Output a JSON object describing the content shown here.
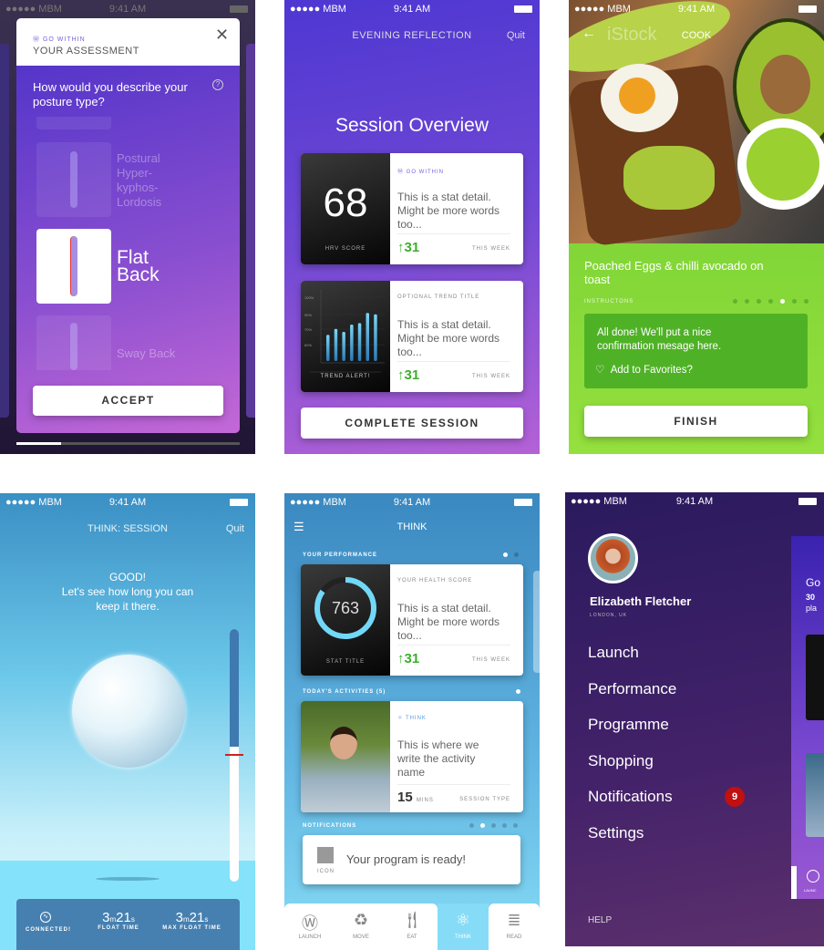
{
  "status_bar": {
    "carrier": "●●●●● MBM",
    "time": "9:41 AM"
  },
  "assessment": {
    "brand": "GO WITHIN",
    "title": "YOUR ASSESSMENT",
    "question": "How would you describe your posture type?",
    "options": [
      {
        "label": "Postural Hyper-kyphos-Lordosis"
      },
      {
        "label": "Flat Back",
        "selected": true
      },
      {
        "label": "Sway Back"
      }
    ],
    "accept": "ACCEPT",
    "progress_percent": 20
  },
  "reflection": {
    "header": "EVENING REFLECTION",
    "quit": "Quit",
    "title": "Session Overview",
    "card1": {
      "score": "68",
      "score_label": "HRV SCORE",
      "brand": "GO WITHIN",
      "detail": "This is a stat detail. Might be more words too...",
      "delta": "31",
      "period": "THIS WEEK"
    },
    "card2": {
      "trend_title": "OPTIONAL TREND TITLE",
      "alert": "TREND ALERT!",
      "ticks": [
        "100%",
        "90%",
        "70%",
        "60%"
      ],
      "bars": [
        73,
        77,
        75,
        80,
        81,
        88,
        87
      ],
      "detail": "This is a stat detail. Might be more words too...",
      "delta": "31",
      "period": "THIS WEEK"
    },
    "complete": "COMPLETE SESSION"
  },
  "cook": {
    "header": "COOK",
    "watermark": "iStock",
    "title": "Poached Eggs & chilli avocado on toast",
    "instructions": "INSTRUCTONS",
    "step_total": 7,
    "step_current": 5,
    "message": "All done! We'll put a nice confirmation mesage here.",
    "favorite": "Add to Favorites?",
    "finish": "FINISH",
    "colors": {
      "green": "#74d031",
      "box": "#4fb226"
    }
  },
  "think_session": {
    "header": "THINK: SESSION",
    "quit": "Quit",
    "message_title": "GOOD!",
    "message": "Let's see how long you can keep it there.",
    "level_percent": 57,
    "stats": [
      {
        "label": "CONNECTED!"
      },
      {
        "m": "3",
        "s": "21",
        "label": "FLOAT TIME"
      },
      {
        "m": "3",
        "s": "21",
        "label": "MAX FLOAT TIME"
      }
    ],
    "unit_m": "m",
    "unit_s": "s"
  },
  "think": {
    "header": "THINK",
    "perf_label": "YOUR PERFORMANCE",
    "card1": {
      "score": "763",
      "score_label": "STAT TITLE",
      "subtitle": "YOUR HEALTH SCORE",
      "detail": "This is a stat detail. Might be more words too...",
      "delta": "31",
      "period": "THIS WEEK",
      "ring_percent": 85
    },
    "activities_label": "TODAY'S ACTIVITIES (5)",
    "card2": {
      "tag": "THINK",
      "name": "This is where we write the activity name",
      "mins": "15",
      "mins_label": "MINS",
      "type": "SESSION TYPE"
    },
    "notifications_label": "NOTIFICATIONS",
    "notification": {
      "icon_label": "ICON",
      "text": "Your program is ready!"
    },
    "tabs": [
      {
        "label": "LAUNCH",
        "icon": "launch-icon"
      },
      {
        "label": "MOVE",
        "icon": "recycle-icon"
      },
      {
        "label": "EAT",
        "icon": "cutlery-icon"
      },
      {
        "label": "THINK",
        "icon": "atom-icon",
        "active": true
      },
      {
        "label": "READ",
        "icon": "lines-icon"
      }
    ]
  },
  "menu": {
    "name": "Elizabeth Fletcher",
    "location": "LONDON, UK",
    "items": [
      "Launch",
      "Performance",
      "Programme",
      "Shopping",
      "Notifications",
      "Settings"
    ],
    "badge": "9",
    "help": "HELP",
    "peek": {
      "title": "Go",
      "count": "30",
      "sub": "pla",
      "launch": "LAUNC"
    }
  }
}
